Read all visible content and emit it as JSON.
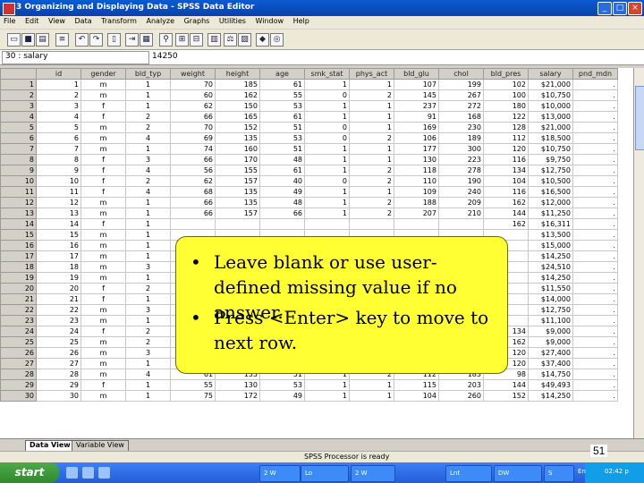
{
  "window": {
    "title": "3 Organizing and Displaying Data - SPSS Data Editor",
    "controls": [
      "_",
      "□",
      "×"
    ]
  },
  "menu": [
    "File",
    "Edit",
    "View",
    "Data",
    "Transform",
    "Analyze",
    "Graphs",
    "Utilities",
    "Window",
    "Help"
  ],
  "cell_editor": {
    "ref": "30 : salary",
    "value": "14250"
  },
  "grid": {
    "columns": [
      "id",
      "gender",
      "bld_typ",
      "weight",
      "height",
      "age",
      "smk_stat",
      "phys_act",
      "bld_glu",
      "chol",
      "bld_pres",
      "salary",
      "pnd_mdn"
    ],
    "rows": [
      [
        "1",
        "1",
        "m",
        "1",
        "70",
        "185",
        "61",
        "1",
        "1",
        "107",
        "199",
        "102",
        "$21,000",
        "."
      ],
      [
        "2",
        "2",
        "m",
        "1",
        "60",
        "162",
        "55",
        "0",
        "2",
        "145",
        "267",
        "100",
        "$10,750",
        "."
      ],
      [
        "3",
        "3",
        "f",
        "1",
        "62",
        "150",
        "53",
        "1",
        "1",
        "237",
        "272",
        "180",
        "$10,000",
        "."
      ],
      [
        "4",
        "4",
        "f",
        "2",
        "66",
        "165",
        "61",
        "1",
        "1",
        "91",
        "168",
        "122",
        "$13,000",
        "."
      ],
      [
        "5",
        "5",
        "m",
        "2",
        "70",
        "152",
        "51",
        "0",
        "1",
        "169",
        "230",
        "128",
        "$21,000",
        "."
      ],
      [
        "6",
        "6",
        "m",
        "4",
        "69",
        "135",
        "53",
        "0",
        "2",
        "106",
        "189",
        "112",
        "$18,500",
        "."
      ],
      [
        "7",
        "7",
        "m",
        "1",
        "74",
        "160",
        "51",
        "1",
        "1",
        "177",
        "300",
        "120",
        "$10,750",
        "."
      ],
      [
        "8",
        "8",
        "f",
        "3",
        "66",
        "170",
        "48",
        "1",
        "1",
        "130",
        "223",
        "116",
        "$9,750",
        "."
      ],
      [
        "9",
        "9",
        "f",
        "4",
        "56",
        "155",
        "61",
        "1",
        "2",
        "118",
        "278",
        "134",
        "$12,750",
        "."
      ],
      [
        "10",
        "10",
        "f",
        "2",
        "62",
        "157",
        "40",
        "0",
        "2",
        "110",
        "190",
        "104",
        "$10,500",
        "."
      ],
      [
        "11",
        "11",
        "f",
        "4",
        "68",
        "135",
        "49",
        "1",
        "1",
        "109",
        "240",
        "116",
        "$16,500",
        "."
      ],
      [
        "12",
        "12",
        "m",
        "1",
        "66",
        "135",
        "48",
        "1",
        "2",
        "188",
        "209",
        "162",
        "$12,000",
        "."
      ],
      [
        "13",
        "13",
        "m",
        "1",
        "66",
        "157",
        "66",
        "1",
        "2",
        "207",
        "210",
        "144",
        "$11,250",
        "."
      ],
      [
        "14",
        "14",
        "f",
        "1",
        "",
        "",
        "",
        "",
        "",
        "",
        "",
        "162",
        "$16,311",
        "."
      ],
      [
        "15",
        "15",
        "m",
        "1",
        "",
        "",
        "",
        "",
        "",
        "",
        "",
        "",
        "$13,500",
        "."
      ],
      [
        "16",
        "16",
        "m",
        "1",
        "",
        "",
        "",
        "",
        "",
        "",
        "",
        "",
        "$15,000",
        "."
      ],
      [
        "17",
        "17",
        "m",
        "1",
        "",
        "",
        "",
        "",
        "",
        "",
        "",
        "",
        "$14,250",
        "."
      ],
      [
        "18",
        "18",
        "m",
        "3",
        "",
        "",
        "",
        "",
        "",
        "",
        "",
        "",
        "$24,510",
        "."
      ],
      [
        "19",
        "19",
        "m",
        "1",
        "",
        "",
        "",
        "",
        "",
        "",
        "",
        "",
        "$14,250",
        "."
      ],
      [
        "20",
        "20",
        "f",
        "2",
        "",
        "",
        "",
        "",
        "",
        "",
        "",
        "",
        "$11,550",
        "."
      ],
      [
        "21",
        "21",
        "f",
        "1",
        "",
        "",
        "",
        "",
        "",
        "",
        "",
        "",
        "$14,000",
        "."
      ],
      [
        "22",
        "22",
        "m",
        "3",
        "",
        "",
        "",
        "",
        "",
        "",
        "",
        "",
        "$12,750",
        "."
      ],
      [
        "23",
        "23",
        "m",
        "1",
        "",
        "",
        "",
        "",
        "",
        "",
        "",
        "",
        "$11,100",
        "."
      ],
      [
        "24",
        "24",
        "f",
        "2",
        "",
        "",
        "",
        "",
        "",
        "",
        "",
        "134",
        "$9,000",
        "."
      ],
      [
        "25",
        "25",
        "m",
        "2",
        "",
        "",
        "",
        "",
        "",
        "",
        "",
        "162",
        "$9,000",
        "."
      ],
      [
        "26",
        "26",
        "m",
        "3",
        "63",
        "147",
        "55",
        "0",
        "2",
        "221",
        "192",
        "120",
        "$27,400",
        "."
      ],
      [
        "27",
        "27",
        "m",
        "1",
        "66",
        "157",
        "49",
        "1",
        "2",
        "170",
        "211",
        "120",
        "$37,400",
        "."
      ],
      [
        "28",
        "28",
        "m",
        "4",
        "61",
        "135",
        "51",
        "1",
        "2",
        "112",
        "183",
        "98",
        "$14,750",
        "."
      ],
      [
        "29",
        "29",
        "f",
        "1",
        "55",
        "130",
        "53",
        "1",
        "1",
        "115",
        "203",
        "144",
        "$49,493",
        "."
      ],
      [
        "30",
        "30",
        "m",
        "1",
        "75",
        "172",
        "49",
        "1",
        "1",
        "104",
        "260",
        "152",
        "$14,250",
        "."
      ]
    ]
  },
  "tabs": [
    "Data View",
    "Variable View"
  ],
  "status": "SPSS Processor  is ready",
  "taskbar": {
    "start": "start",
    "tasks": [
      "2 W",
      "Lo",
      "2 W",
      "Lnt",
      "DW",
      "S",
      "En"
    ],
    "clock": "02:42 p"
  },
  "note": {
    "bullets": [
      "Leave blank or use user-defined missing value if no answer.",
      "Press <Enter> key to move to next row."
    ]
  },
  "page_number": "51"
}
